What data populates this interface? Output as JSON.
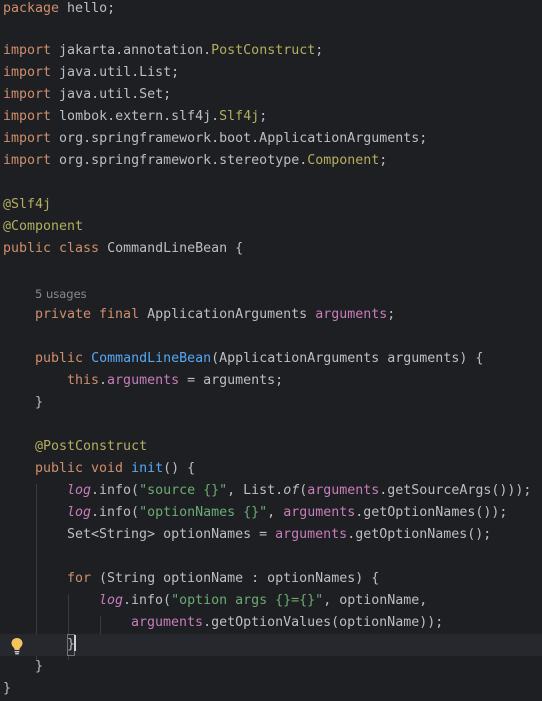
{
  "code": {
    "package_line": [
      "package",
      " hello;"
    ],
    "imports": [
      [
        "import",
        " jakarta.annotation.",
        "PostConstruct",
        ";"
      ],
      [
        "import",
        " java.util.List;",
        "",
        ""
      ],
      [
        "import",
        " java.util.Set;",
        "",
        ""
      ],
      [
        "import",
        " lombok.extern.slf4j.",
        "Slf4j",
        ";"
      ],
      [
        "import",
        " org.springframework.boot.ApplicationArguments;",
        "",
        ""
      ],
      [
        "import",
        " org.springframework.stereotype.",
        "Component",
        ";"
      ]
    ],
    "class_annotations": [
      "@Slf4j",
      "@Component"
    ],
    "class_decl": {
      "mod": "public class",
      "name": " CommandLineBean {"
    },
    "usages_hint": "5 usages",
    "field_decl": {
      "mod": "private final",
      "type": " ApplicationArguments ",
      "name": "arguments",
      "end": ";"
    },
    "ctor_decl": {
      "mod": "public",
      "name": "CommandLineBean",
      "params": "(ApplicationArguments arguments) {"
    },
    "ctor_body": {
      "kw": "this",
      "dot": ".",
      "field": "arguments",
      "rest": " = arguments;"
    },
    "close_brace": "}",
    "method_annotation": "@PostConstruct",
    "method_decl": {
      "mod": "public void",
      "name": "init",
      "rest": "() {"
    },
    "log1": {
      "log": "log",
      "a": ".info(",
      "s": "\"source {}\"",
      "b": ", List.",
      "of": "of",
      "c": "(",
      "f": "arguments",
      "d": ".getSourceArgs()));"
    },
    "log2": {
      "log": "log",
      "a": ".info(",
      "s": "\"optionNames {}\"",
      "b": ", ",
      "f": "arguments",
      "d": ".getOptionNames());"
    },
    "set_line": {
      "a": "Set<String> optionNames = ",
      "f": "arguments",
      "d": ".getOptionNames();"
    },
    "for_line": {
      "kw": "for",
      "rest": " (String optionName : optionNames) {"
    },
    "log3": {
      "log": "log",
      "a": ".info(",
      "s": "\"option args {}={}\"",
      "b": ", optionName,"
    },
    "log3_cont": {
      "f": "arguments",
      "d": ".getOptionValues(optionName));"
    },
    "inner_close": "}",
    "final_close": "}"
  },
  "colors": {
    "background": "#1e1f22",
    "keyword": "#cf8e6d",
    "string": "#6aab73",
    "annotation": "#b3ae60",
    "field": "#c77dbb",
    "method": "#56a8f5",
    "text": "#bcbec4"
  },
  "icons": {
    "gutter": "lightbulb-icon"
  }
}
